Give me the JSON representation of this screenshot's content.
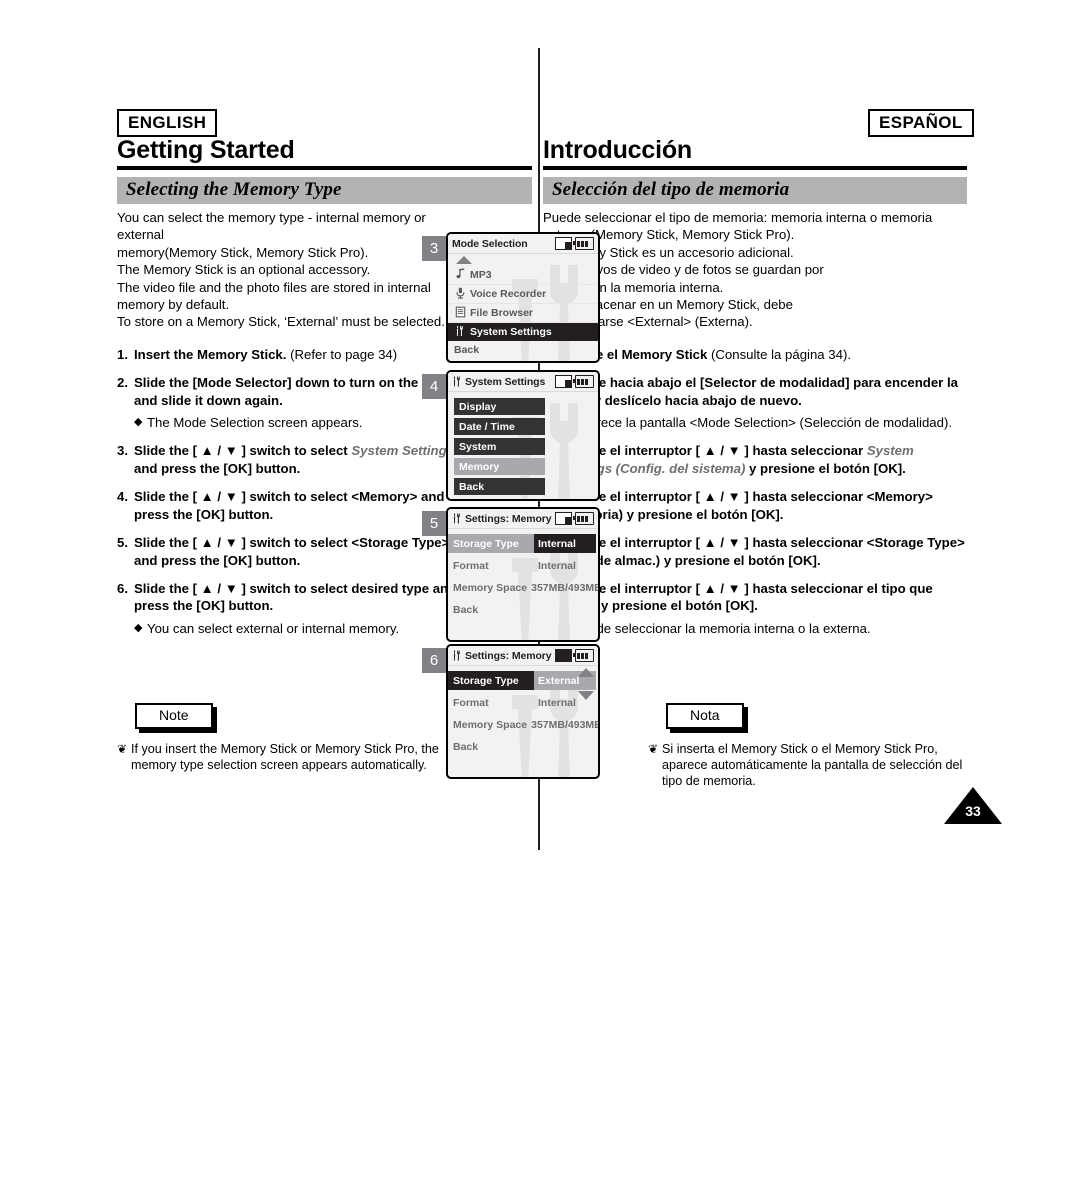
{
  "page": {
    "number": "33",
    "english_tag": "ENGLISH",
    "spanish_tag": "ESPAÑOL",
    "chapter_en": "Getting Started",
    "chapter_es": "Introducción",
    "section_en": "Selecting the Memory Type",
    "section_es": "Selección del tipo de memoria"
  },
  "english": {
    "intro": "You can select the memory type - internal memory or external\nmemory(Memory Stick, Memory Stick Pro).\nThe Memory Stick is an optional accessory.\nThe video file and the photo files are stored in internal\nmemory by default.\nTo store on a Memory Stick, ‘External’ must be selected.",
    "steps": [
      {
        "num": "1.",
        "bold": "Insert the Memory Stick.",
        "regular": " (Refer to page 34)",
        "bullets": []
      },
      {
        "num": "2.",
        "bold": "Slide the [Mode Selector] down to turn on the CAM and slide it down again.",
        "regular": "",
        "bullets": [
          "The Mode Selection screen appears."
        ]
      },
      {
        "num": "3.",
        "bold": "Slide the [ ▲ / ▼ ] switch to select ",
        "italic": "System Settings",
        "bold2": " and press the [OK] button.",
        "regular": "",
        "bullets": []
      },
      {
        "num": "4.",
        "bold": "Slide the [ ▲ / ▼ ] switch to select <Memory> and press the [OK] button.",
        "regular": "",
        "bullets": []
      },
      {
        "num": "5.",
        "bold": "Slide the [ ▲ / ▼ ] switch to select <Storage Type> and press the [OK] button.",
        "regular": "",
        "bullets": []
      },
      {
        "num": "6.",
        "bold": "Slide the [ ▲ / ▼ ] switch to select desired type and press the [OK] button.",
        "regular": "",
        "bullets": [
          "You can select external or internal memory."
        ]
      }
    ],
    "note_label": "Note",
    "notes": [
      "If you insert the Memory Stick or Memory Stick Pro, the memory type selection screen appears automatically."
    ]
  },
  "spanish": {
    "intro": "Puede seleccionar el tipo de memoria: memoria interna o memoria\nexterna (Memory Stick, Memory Stick Pro).\nEl Memory Stick es un accesorio adicional.\nLos archivos de video y de fotos se guardan por\nomisión en la memoria interna.\nPara almacenar en un Memory Stick, debe\nseleccionarse <External> (Externa).",
    "steps": [
      {
        "num": "1.",
        "bold": "Inserte el Memory Stick",
        "regular": " (Consulte la página 34).",
        "bullets": []
      },
      {
        "num": "2.",
        "bold": "Deslice hacia abajo el [Selector de modalidad] para encender la CAM y deslícelo hacia abajo de nuevo.",
        "regular": "",
        "bullets": [
          "Aparece la pantalla <Mode Selection> (Selección de modalidad)."
        ]
      },
      {
        "num": "3.",
        "bold": "Deslice el interruptor [ ▲ / ▼ ] hasta seleccionar ",
        "italic": "System Settings (Config. del sistema)",
        "bold2": " y presione el botón [OK].",
        "regular": "",
        "bullets": []
      },
      {
        "num": "4.",
        "bold": "Deslice el interruptor [ ▲ / ▼ ] hasta seleccionar <Memory> (Memoria) y presione el botón [OK].",
        "regular": "",
        "bullets": []
      },
      {
        "num": "5.",
        "bold": "Deslice el interruptor [ ▲ / ▼ ] hasta seleccionar <Storage Type> (Tipo de almac.) y presione el botón [OK].",
        "regular": "",
        "bullets": []
      },
      {
        "num": "6.",
        "bold": "Deslice el interruptor [ ▲ / ▼ ] hasta seleccionar el tipo que desea y presione el botón [OK].",
        "regular": "",
        "bullets": [
          "Puede seleccionar la memoria interna o la externa."
        ]
      }
    ],
    "note_label": "Nota",
    "notes": [
      "Si inserta el Memory Stick o el Memory Stick Pro, aparece automáticamente la pantalla de selección del tipo de memoria."
    ]
  },
  "screens": [
    {
      "step": "3",
      "title": "Mode Selection",
      "items": [
        {
          "icon": "music-note-icon",
          "glyph": "♪",
          "label": "MP3",
          "state": "normal"
        },
        {
          "icon": "microphone-icon",
          "glyph": "🎤",
          "label": "Voice Recorder",
          "state": "normal"
        },
        {
          "icon": "file-browser-icon",
          "glyph": "▤",
          "label": "File Browser",
          "state": "normal"
        },
        {
          "icon": "tools-icon",
          "glyph": "⚒",
          "label": "System Settings",
          "state": "selected"
        },
        {
          "icon": "",
          "glyph": "",
          "label": "Back",
          "state": "plain"
        }
      ]
    },
    {
      "step": "4",
      "title": "System Settings",
      "title_icon": "tools-icon",
      "buttons": [
        {
          "label": "Display",
          "state": "normal"
        },
        {
          "label": "Date / Time",
          "state": "normal"
        },
        {
          "label": "System",
          "state": "normal"
        },
        {
          "label": "Memory",
          "state": "highlighted"
        },
        {
          "label": "Back",
          "state": "normal"
        }
      ]
    },
    {
      "step": "5",
      "title": "Settings: Memory",
      "title_icon": "tools-icon",
      "rows": [
        {
          "key": "Storage Type",
          "key_state": "gray",
          "value": "Internal",
          "value_state": "dark"
        },
        {
          "key": "Format",
          "key_state": "plain",
          "value": "Internal",
          "value_state": "plain"
        },
        {
          "key": "Memory Space",
          "key_state": "plain",
          "value": "357MB/493MB",
          "value_state": "plain"
        },
        {
          "key": "Back",
          "key_state": "plain",
          "value": "",
          "value_state": "plain"
        }
      ],
      "scroll": false
    },
    {
      "step": "6",
      "title": "Settings: Memory",
      "title_icon": "tools-icon",
      "rows": [
        {
          "key": "Storage Type",
          "key_state": "dark",
          "value": "External",
          "value_state": "gray"
        },
        {
          "key": "Format",
          "key_state": "plain",
          "value": "Internal",
          "value_state": "plain"
        },
        {
          "key": "Memory Space",
          "key_state": "plain",
          "value": "357MB/493MB",
          "value_state": "plain"
        },
        {
          "key": "Back",
          "key_state": "plain",
          "value": "",
          "value_state": "plain"
        }
      ],
      "scroll": true
    }
  ],
  "colors": {
    "section_bar": "#b3b3b3",
    "lcd_bg": "#f2f2f2",
    "lcd_dark": "#231f20",
    "lcd_gray": "#a7a9ac",
    "step_badge": "#808285"
  }
}
